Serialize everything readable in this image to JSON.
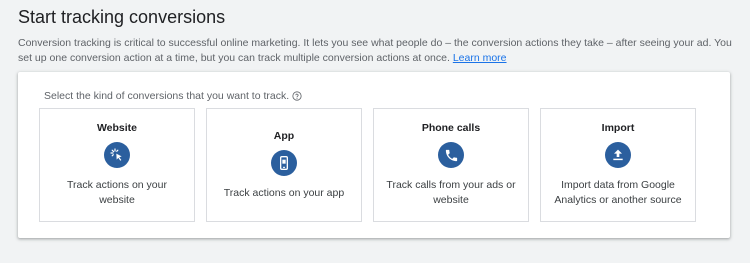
{
  "page": {
    "title": "Start tracking conversions",
    "description": "Conversion tracking is critical to successful online marketing. It lets you see what people do – the conversion actions they take – after seeing your ad. You set up one conversion action at a time, but you can track multiple conversion actions at once.",
    "learn_more": "Learn more"
  },
  "card": {
    "prompt": "Select the kind of conversions that you want to track.",
    "options": [
      {
        "title": "Website",
        "description": "Track actions on your website",
        "icon": "cursor-click-icon"
      },
      {
        "title": "App",
        "description": "Track actions on your app",
        "icon": "mobile-app-icon"
      },
      {
        "title": "Phone calls",
        "description": "Track calls from your ads or website",
        "icon": "phone-icon"
      },
      {
        "title": "Import",
        "description": "Import data from Google Analytics or another source",
        "icon": "upload-icon"
      }
    ]
  },
  "colors": {
    "icon_background": "#2b5f9e",
    "link": "#1a73e8",
    "page_background": "#f1f3f4"
  }
}
